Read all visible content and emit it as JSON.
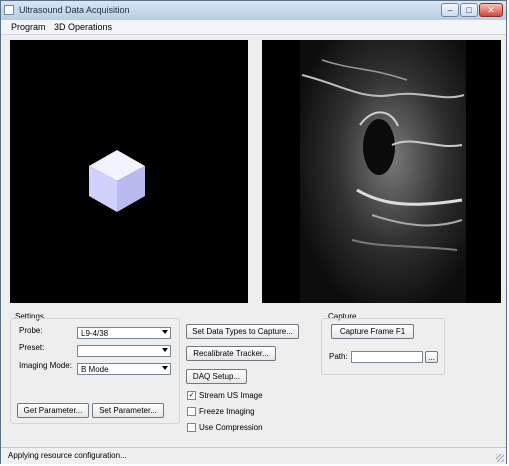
{
  "window": {
    "title": "Ultrasound Data Acquisition",
    "buttons": {
      "minimize": "–",
      "maximize": "□",
      "close": "✕"
    }
  },
  "menu": [
    "Program",
    "3D Operations"
  ],
  "settings": {
    "label": "Settings",
    "probe_label": "Probe:",
    "probe_value": "L9-4/38",
    "preset_label": "Preset:",
    "preset_value": "",
    "imaging_mode_label": "Imaging Mode:",
    "imaging_mode_value": "B Mode",
    "get_parameter": "Get Parameter...",
    "set_parameter": "Set Parameter..."
  },
  "actions": {
    "set_data_types": "Set Data Types to Capture...",
    "recalibrate_tracker": "Recalibrate Tracker...",
    "daq_setup": "DAQ Setup...",
    "stream_us_image": {
      "label": "Stream US Image",
      "checked": true
    },
    "freeze_imaging": {
      "label": "Freeze Imaging",
      "checked": false
    },
    "use_compression": {
      "label": "Use Compression",
      "checked": false
    }
  },
  "capture": {
    "label": "Capture",
    "capture_frame": "Capture Frame F1",
    "path_label": "Path:",
    "path_value": "",
    "browse": "..."
  },
  "status": "Applying resource configuration...",
  "icons": {
    "check": "✓"
  },
  "colors": {
    "viewport": "#000000",
    "cube": "#d7d8ff"
  }
}
